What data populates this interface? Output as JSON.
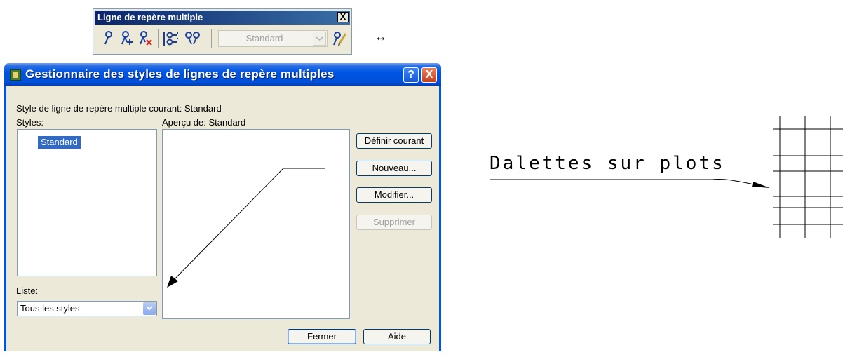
{
  "toolbar": {
    "title": "Ligne de repère multiple",
    "close_label": "X",
    "style_combo": "Standard",
    "tools": [
      "multileader-icon",
      "add-leader-icon",
      "remove-leader-icon",
      "align-leaders-icon",
      "collect-leaders-icon",
      "multileader-style-icon"
    ]
  },
  "drag_indicator": "↔",
  "dialog": {
    "title": "Gestionnaire des styles de lignes de repère multiples",
    "help_label": "?",
    "close_label": "X",
    "current_style_label": "Style de ligne de repère multiple courant: Standard",
    "styles_label": "Styles:",
    "styles_list": [
      "Standard"
    ],
    "preview_label": "Aperçu de: Standard",
    "list_label": "Liste:",
    "list_value": "Tous les styles",
    "buttons": {
      "set_current": "Définir courant",
      "new": "Nouveau...",
      "modify": "Modifier...",
      "delete": "Supprimer",
      "close": "Fermer",
      "help": "Aide"
    }
  },
  "drawing": {
    "label": "Dalettes sur plots"
  }
}
